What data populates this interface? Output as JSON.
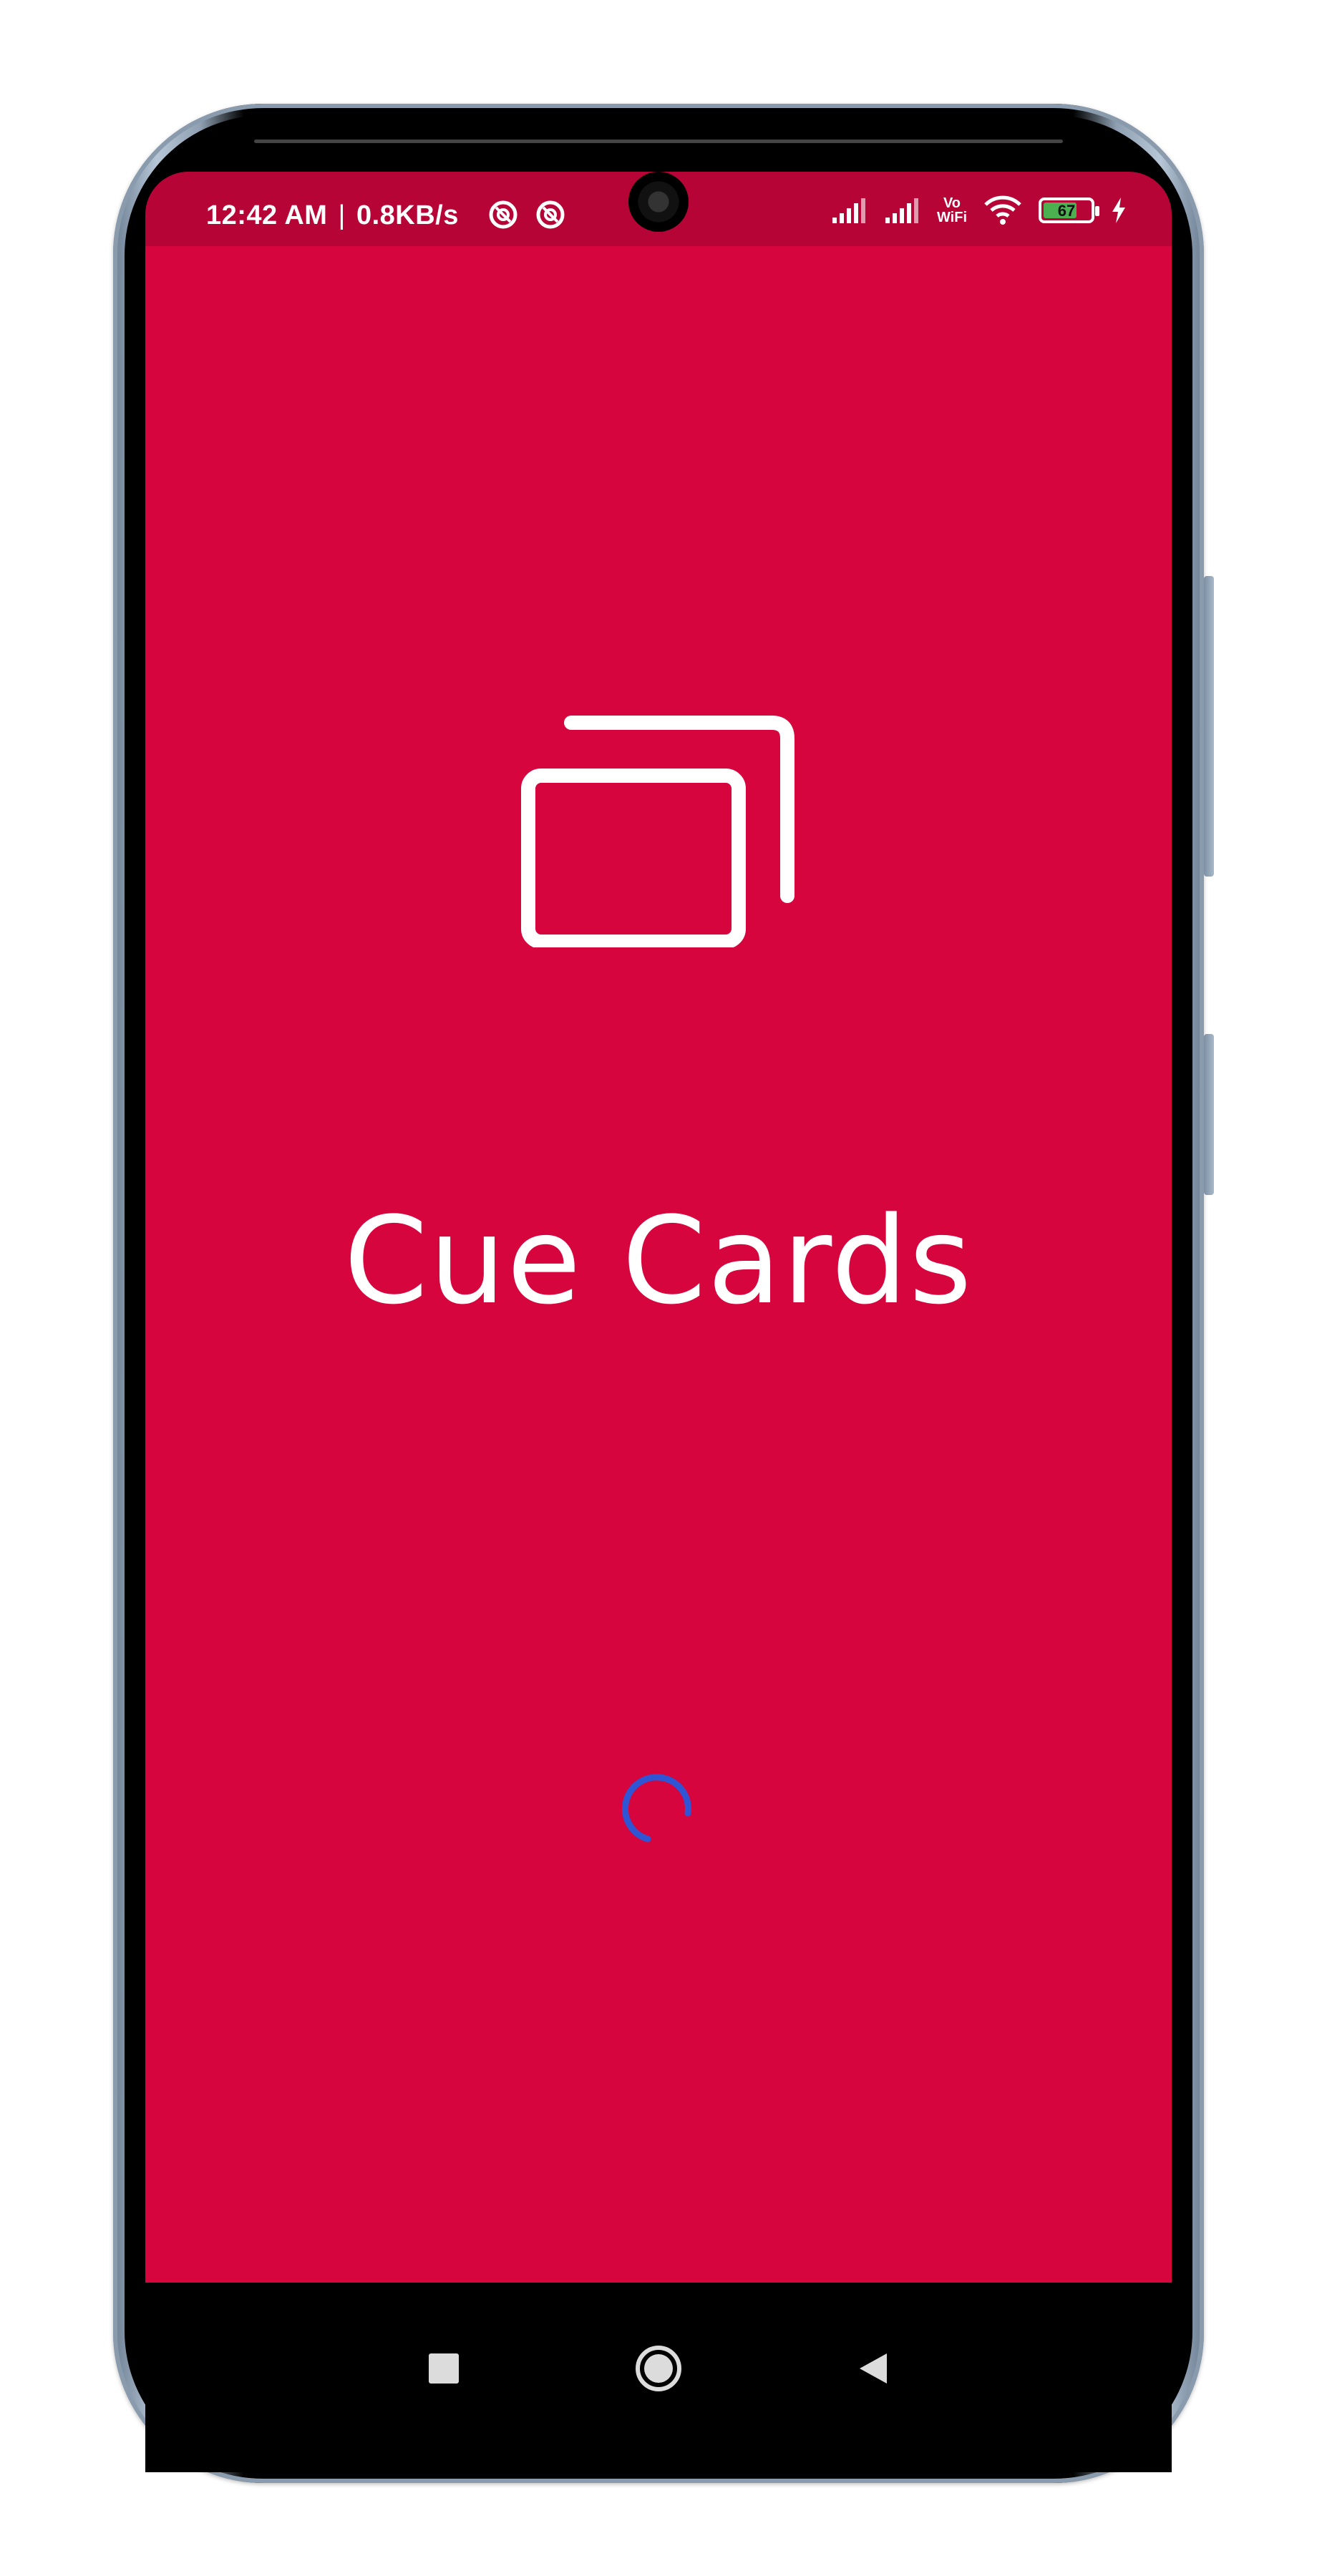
{
  "status_bar": {
    "time": "12:42 AM",
    "separator": "|",
    "speed": "0.8KB/s",
    "battery": "67",
    "vowifi_top": "Vo",
    "vowifi_bottom": "WiFi",
    "icons_left": [
      "sync-icon",
      "sync-icon"
    ],
    "icons_right": [
      "signal-icon",
      "signal-icon",
      "vowifi-icon",
      "wifi-icon",
      "battery-icon",
      "charging-icon"
    ]
  },
  "app": {
    "title": "Cue Cards",
    "logo": "cards-stack-icon",
    "background_color": "#d6053d",
    "spinner_color": "#2f55d4"
  },
  "nav": {
    "buttons": [
      "recents-icon",
      "home-icon",
      "back-icon"
    ]
  }
}
